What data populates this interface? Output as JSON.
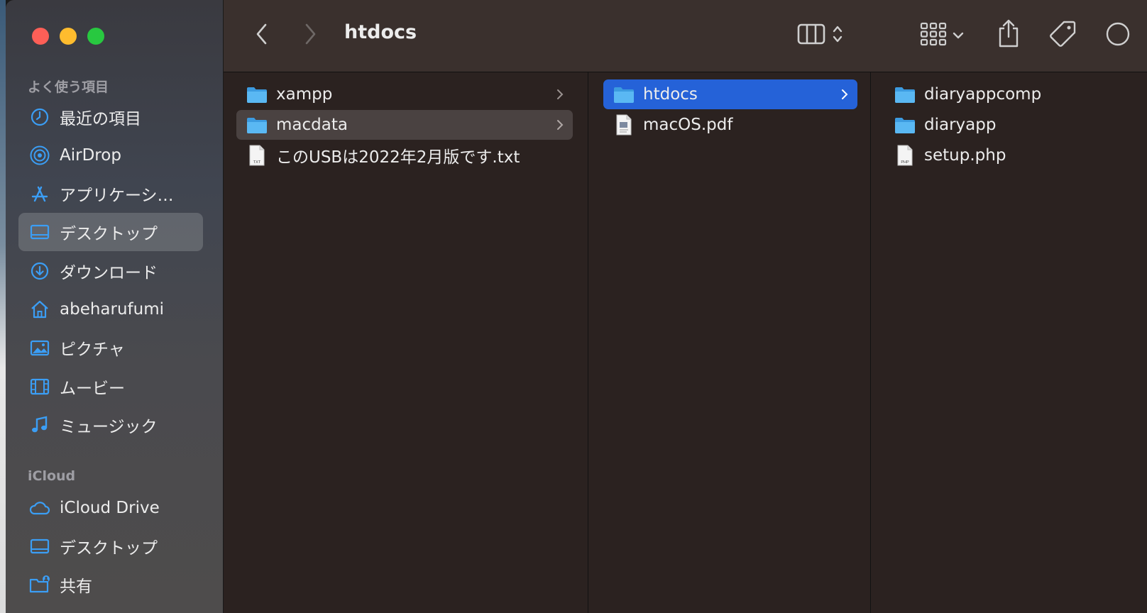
{
  "window": {
    "title": "htdocs"
  },
  "sidebar": {
    "favorites_header": "よく使う項目",
    "favorites": [
      {
        "label": "最近の項目",
        "icon": "clock-icon"
      },
      {
        "label": "AirDrop",
        "icon": "airdrop-icon"
      },
      {
        "label": "アプリケーシ…",
        "icon": "applications-icon"
      },
      {
        "label": "デスクトップ",
        "icon": "desktop-icon",
        "selected": true
      },
      {
        "label": "ダウンロード",
        "icon": "download-icon"
      },
      {
        "label": "abeharufumi",
        "icon": "home-icon"
      },
      {
        "label": "ピクチャ",
        "icon": "pictures-icon"
      },
      {
        "label": "ムービー",
        "icon": "movies-icon"
      },
      {
        "label": "ミュージック",
        "icon": "music-icon"
      }
    ],
    "icloud_header": "iCloud",
    "icloud": [
      {
        "label": "iCloud Drive",
        "icon": "cloud-icon"
      },
      {
        "label": "デスクトップ",
        "icon": "desktop-icon"
      },
      {
        "label": "共有",
        "icon": "shared-folder-icon"
      }
    ]
  },
  "columns": [
    {
      "items": [
        {
          "name": "xampp",
          "kind": "folder",
          "has_children": true
        },
        {
          "name": "macdata",
          "kind": "folder",
          "has_children": true,
          "state": "selected-inactive"
        },
        {
          "name": "このUSBは2022年2月版です.txt",
          "kind": "txt"
        }
      ]
    },
    {
      "items": [
        {
          "name": "htdocs",
          "kind": "folder",
          "has_children": true,
          "state": "selected-active"
        },
        {
          "name": "macOS.pdf",
          "kind": "pdf"
        }
      ]
    },
    {
      "items": [
        {
          "name": "diaryappcomp",
          "kind": "folder"
        },
        {
          "name": "diaryapp",
          "kind": "folder"
        },
        {
          "name": "setup.php",
          "kind": "php"
        }
      ]
    }
  ],
  "colors": {
    "accent": "#2562d8",
    "folder": "#4fb0ef",
    "sidebar_icon": "#3b9ef5"
  }
}
